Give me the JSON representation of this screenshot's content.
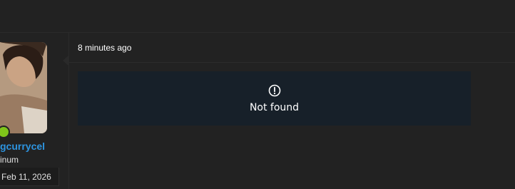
{
  "post": {
    "timestamp": "8 minutes ago",
    "notice": {
      "icon": "alert-circle-icon",
      "text": "Not found"
    }
  },
  "author": {
    "username": "gcurrycel",
    "title": "inum",
    "join_date": "Feb 11, 2026",
    "online": true,
    "username_color": "#2d94e0",
    "online_color": "#7fc41a"
  }
}
